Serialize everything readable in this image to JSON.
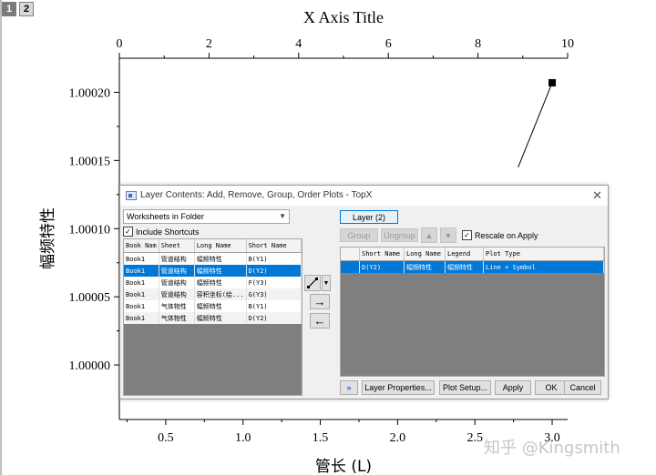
{
  "layers": {
    "tab1": "1",
    "tab2": "2"
  },
  "chart_data": {
    "type": "line",
    "title": "",
    "top_xlabel": "X Axis Title",
    "top_xlim": [
      0,
      10
    ],
    "top_ticks": [
      "0",
      "2",
      "4",
      "6",
      "8",
      "10"
    ],
    "xlabel": "管长 (L)",
    "xlim": [
      0.2,
      3.1
    ],
    "x_ticks": [
      "0.5",
      "1.0",
      "1.5",
      "2.0",
      "2.5",
      "3.0"
    ],
    "ylabel": "幅频特性",
    "ylim": [
      0.99996,
      1.000225
    ],
    "y_ticks": [
      "1.00000",
      "1.00005",
      "1.00010",
      "1.00015",
      "1.00020"
    ],
    "series": [
      {
        "points": [
          {
            "x": 2.78,
            "y": 1.000145
          },
          {
            "x": 3.0,
            "y": 1.000207
          }
        ],
        "marker": "square"
      }
    ]
  },
  "dialog": {
    "title": "Layer Contents: Add, Remove, Group, Order Plots - TopX",
    "source_select": "Worksheets in Folder",
    "include_shortcuts": "Include Shortcuts",
    "left_headers": [
      "Book Nam",
      "Sheet",
      "Long Name",
      "Short Name"
    ],
    "left_rows": [
      [
        "Book1",
        "管道结构",
        "幅频特性",
        "B(Y1)"
      ],
      [
        "Book1",
        "管道结构",
        "幅频特性",
        "D(Y2)"
      ],
      [
        "Book1",
        "管道结构",
        "幅频特性",
        "F(Y3)"
      ],
      [
        "Book1",
        "管道结构",
        "容积坐标(绘...",
        "G(Y3)"
      ],
      [
        "Book1",
        "气体物性",
        "幅频特性",
        "B(Y1)"
      ],
      [
        "Book1",
        "气体物性",
        "幅频特性",
        "D(Y2)"
      ]
    ],
    "layer_button": "Layer (2)",
    "group_button": "Group",
    "ungroup_button": "Ungroup",
    "rescale_label": "Rescale on Apply",
    "right_headers": [
      "Short Name",
      "Long Name",
      "Legend",
      "Plot Type"
    ],
    "right_rows": [
      [
        "D(Y2)",
        "幅频特性",
        "幅频特性",
        "Line + Symbol"
      ]
    ],
    "buttons": {
      "expand": "»",
      "layer_properties": "Layer Properties...",
      "plot_setup": "Plot Setup...",
      "apply": "Apply",
      "ok": "OK",
      "cancel": "Cancel"
    }
  },
  "watermark": "知乎 @Kingsmith"
}
